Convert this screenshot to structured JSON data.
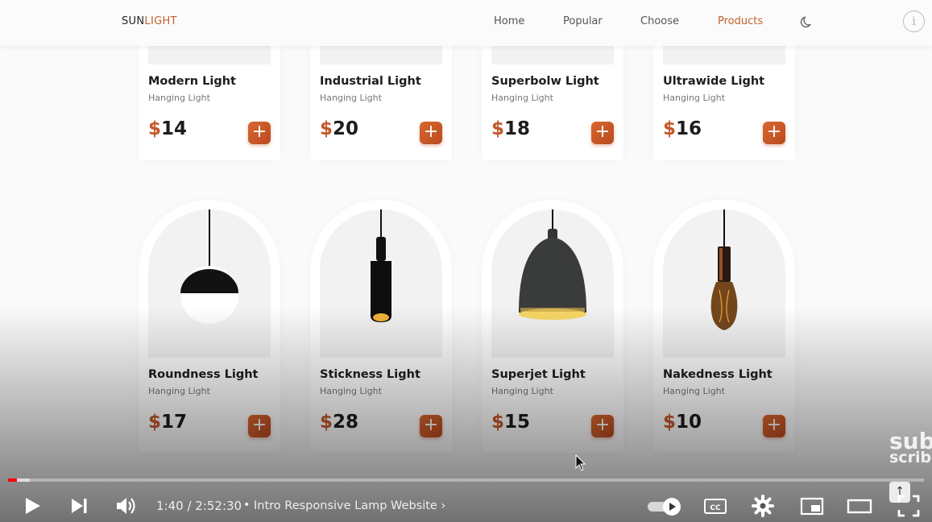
{
  "header": {
    "logo_part1": "SUN",
    "logo_part2": "LIGHT",
    "nav": [
      {
        "label": "Home"
      },
      {
        "label": "Popular"
      },
      {
        "label": "Choose"
      },
      {
        "label": "Products",
        "active": true
      }
    ],
    "theme_icon": "moon-icon",
    "info_icon": "info-icon",
    "info_glyph": "i"
  },
  "colors": {
    "accent": "#c2582a",
    "button": "#cf5f2a",
    "text": "#1d1d1d",
    "nav_active": "#c2612c"
  },
  "products": [
    {
      "name": "Modern Light",
      "type": "Hanging Light",
      "currency": "$",
      "price": "14"
    },
    {
      "name": "Industrial Light",
      "type": "Hanging Light",
      "currency": "$",
      "price": "20"
    },
    {
      "name": "Superbolw Light",
      "type": "Hanging Light",
      "currency": "$",
      "price": "18"
    },
    {
      "name": "Ultrawide Light",
      "type": "Hanging Light",
      "currency": "$",
      "price": "16"
    },
    {
      "name": "Roundness Light",
      "type": "Hanging Light",
      "currency": "$",
      "price": "17"
    },
    {
      "name": "Stickness Light",
      "type": "Hanging Light",
      "currency": "$",
      "price": "28"
    },
    {
      "name": "Superjet Light",
      "type": "Hanging Light",
      "currency": "$",
      "price": "15"
    },
    {
      "name": "Nakedness Light",
      "type": "Hanging Light",
      "currency": "$",
      "price": "10"
    }
  ],
  "add_label": "+",
  "player": {
    "time": "1:40 / 2:52:30",
    "separator": "•",
    "chapter": "Intro Responsive Lamp Website",
    "chapter_chevron": "›",
    "progress_fraction": 0.0097,
    "subscribe_line1": "sub",
    "subscribe_line2": "scribe",
    "icons": [
      "play-icon",
      "next-icon",
      "volume-icon",
      "autoplay-toggle-icon",
      "captions-icon",
      "settings-icon",
      "miniplayer-icon",
      "theater-icon",
      "fullscreen-icon",
      "scroll-up-icon"
    ],
    "cc_label": "CC"
  }
}
